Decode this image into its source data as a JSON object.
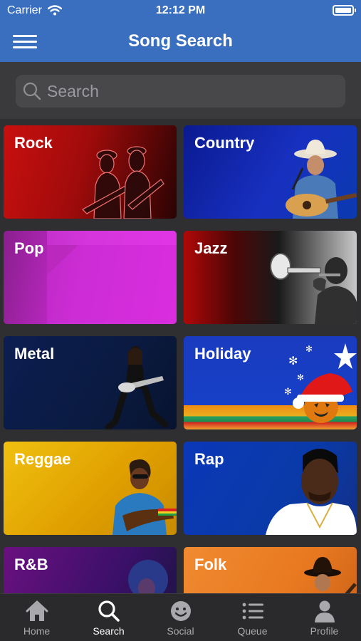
{
  "status_bar": {
    "carrier": "Carrier",
    "time": "12:12 PM"
  },
  "header": {
    "title": "Song Search"
  },
  "search": {
    "placeholder": "Search"
  },
  "genres": [
    {
      "label": "Rock"
    },
    {
      "label": "Country"
    },
    {
      "label": "Pop"
    },
    {
      "label": "Jazz"
    },
    {
      "label": "Metal"
    },
    {
      "label": "Holiday"
    },
    {
      "label": "Reggae"
    },
    {
      "label": "Rap"
    },
    {
      "label": "R&B"
    },
    {
      "label": "Folk"
    }
  ],
  "tabs": [
    {
      "label": "Home",
      "icon": "home-icon"
    },
    {
      "label": "Search",
      "icon": "search-icon",
      "active": true
    },
    {
      "label": "Social",
      "icon": "smiley-icon"
    },
    {
      "label": "Queue",
      "icon": "list-icon"
    },
    {
      "label": "Profile",
      "icon": "person-icon"
    }
  ],
  "colors": {
    "header": "#3a6fc0",
    "background": "#2f2f31",
    "tab_bar": "#2a2a2c"
  }
}
